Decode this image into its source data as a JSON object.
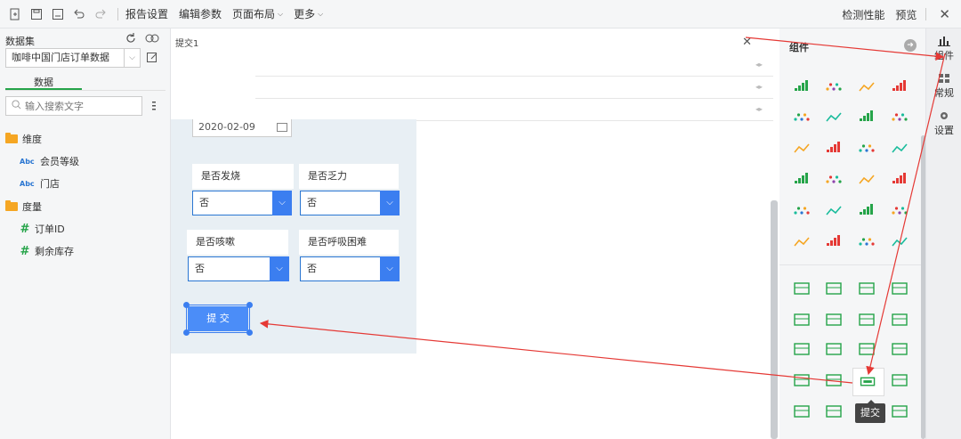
{
  "toolbar": {
    "menus": [
      "报告设置",
      "编辑参数",
      "页面布局",
      "更多"
    ],
    "right_detect": "检测性能",
    "right_preview": "预览"
  },
  "left": {
    "dataset_title": "数据集",
    "dataset_name": "咖啡中国门店订单数据",
    "tab": "数据",
    "search_placeholder": "输入搜索文字",
    "dim_label": "维度",
    "dims": [
      "会员等级",
      "门店"
    ],
    "measure_label": "度量",
    "measures": [
      "订单ID",
      "剩余库存"
    ],
    "abc": "Abc",
    "hash": "#"
  },
  "canvas": {
    "title": "提交1",
    "close": "✕",
    "date_value": "2020-02-09",
    "q1": "是否发烧",
    "q2": "是否乏力",
    "q3": "是否咳嗽",
    "q4": "是否呼吸困难",
    "answer": "否",
    "submit": "提 交"
  },
  "right": {
    "title": "组件",
    "tooltip": "提交"
  },
  "side": {
    "items": [
      "组件",
      "常规",
      "设置"
    ]
  },
  "colors": {
    "accent_blue": "#3b7ef0",
    "green": "#25a449",
    "arrow_red": "#e53935"
  }
}
